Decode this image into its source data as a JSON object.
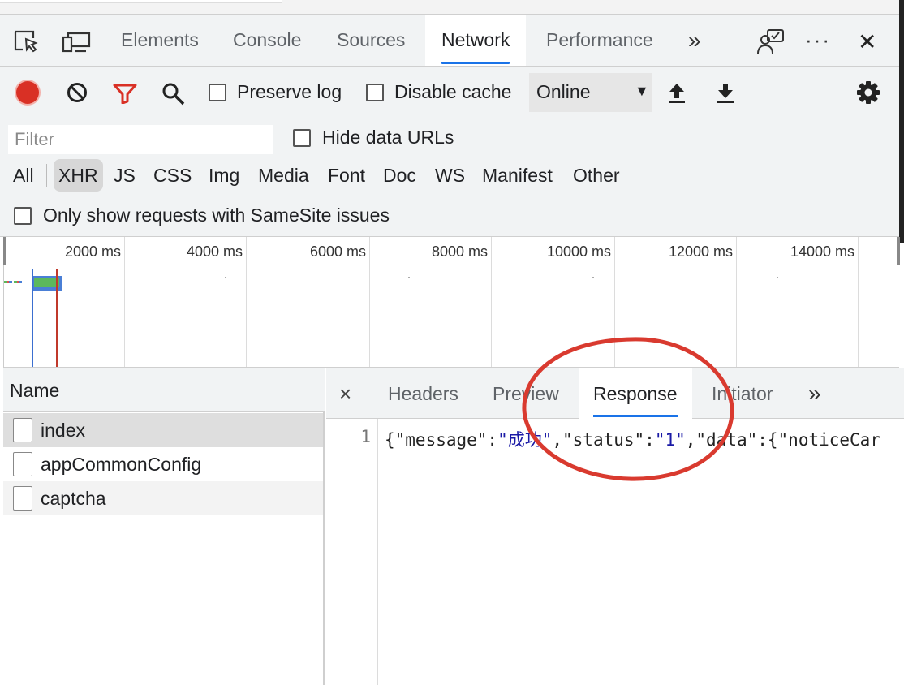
{
  "main_tabs": [
    {
      "label": "Elements"
    },
    {
      "label": "Console"
    },
    {
      "label": "Sources"
    },
    {
      "label": "Network",
      "active": true
    },
    {
      "label": "Performance"
    }
  ],
  "more_tabs_glyph": "»",
  "ellipsis_glyph": "···",
  "close_glyph": "✕",
  "toolbar": {
    "preserve_log": "Preserve log",
    "disable_cache": "Disable cache",
    "throttle": "Online",
    "throttle_arrow": "▼"
  },
  "filter": {
    "placeholder": "Filter",
    "hide_data_urls": "Hide data URLs",
    "types": [
      "All",
      "XHR",
      "JS",
      "CSS",
      "Img",
      "Media",
      "Font",
      "Doc",
      "WS",
      "Manifest",
      "Other"
    ],
    "active_type": "XHR",
    "samesite": "Only show requests with SameSite issues"
  },
  "timeline": {
    "ticks": [
      "2000 ms",
      "4000 ms",
      "6000 ms",
      "8000 ms",
      "10000 ms",
      "12000 ms",
      "14000 ms"
    ]
  },
  "requests": {
    "header": "Name",
    "rows": [
      "index",
      "appCommonConfig",
      "captcha"
    ],
    "selected": "index"
  },
  "detail": {
    "close": "×",
    "tabs": [
      "Headers",
      "Preview",
      "Response",
      "Initiator"
    ],
    "active_tab": "Response",
    "more": "»",
    "line_number": "1",
    "code": {
      "p1": "{\"message\":",
      "v1": "\"成功\"",
      "p2": ",\"status\":",
      "v2": "\"1\"",
      "p3": ",\"data\":{\"noticeCar"
    }
  },
  "colors": {
    "accent": "#1a73e8",
    "record": "#d93025",
    "annotation": "#d93a2f",
    "bar_green": "#5cb85c",
    "bar_blue": "#4a7fd6"
  }
}
